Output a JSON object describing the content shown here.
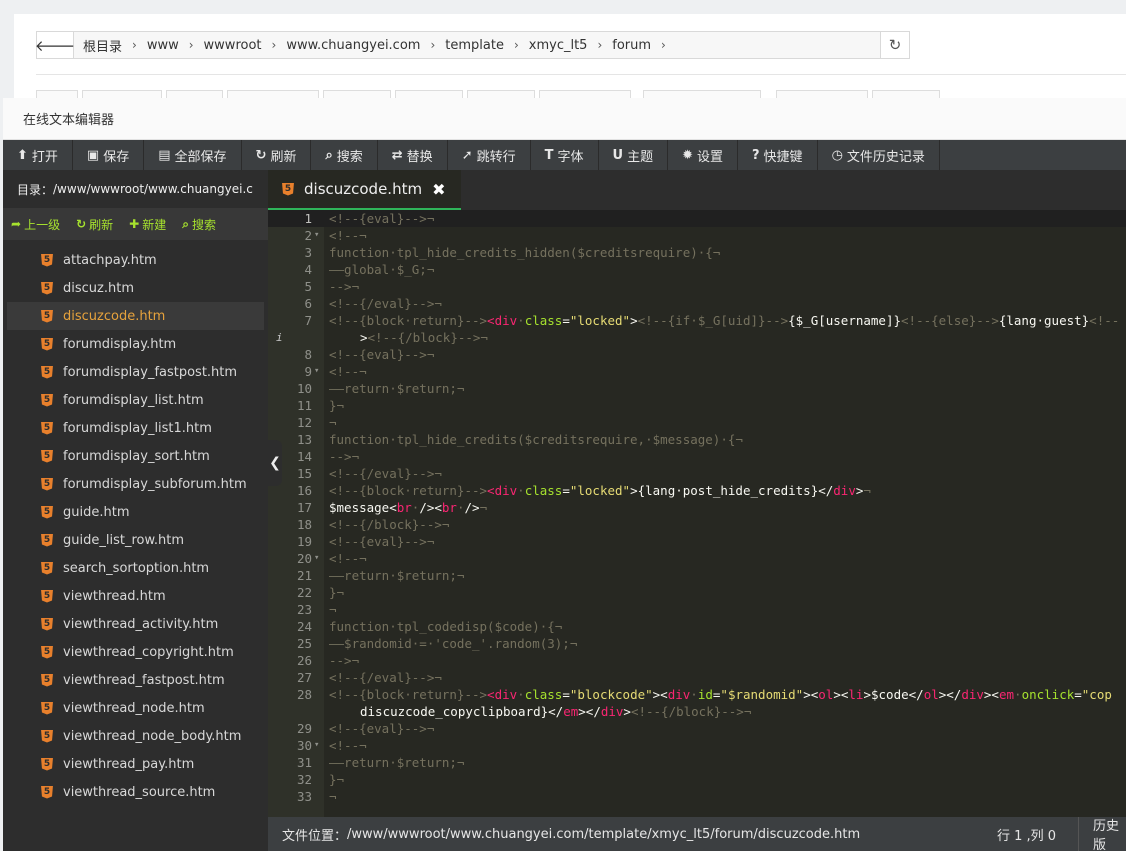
{
  "breadcrumb": [
    "根目录",
    "www",
    "wwwroot",
    "www.chuangyei.com",
    "template",
    "xmyc_lt5",
    "forum"
  ],
  "editor_title": "在线文本编辑器",
  "toolbar": [
    {
      "icon": "upload-icon",
      "glyph": "⬆",
      "label": "打开"
    },
    {
      "icon": "save-icon",
      "glyph": "▣",
      "label": "保存"
    },
    {
      "icon": "save-all-icon",
      "glyph": "▤",
      "label": "全部保存"
    },
    {
      "icon": "refresh-icon",
      "glyph": "↻",
      "label": "刷新"
    },
    {
      "icon": "search-icon",
      "glyph": "⌕",
      "label": "搜索"
    },
    {
      "icon": "replace-icon",
      "glyph": "⇄",
      "label": "替换"
    },
    {
      "icon": "goto-line-icon",
      "glyph": "➚",
      "label": "跳转行"
    },
    {
      "icon": "font-icon",
      "glyph": "T",
      "label": "字体"
    },
    {
      "icon": "theme-icon",
      "glyph": "U",
      "label": "主题"
    },
    {
      "icon": "settings-icon",
      "glyph": "✹",
      "label": "设置"
    },
    {
      "icon": "help-icon",
      "glyph": "?",
      "label": "快捷键"
    },
    {
      "icon": "history-icon",
      "glyph": "◷",
      "label": "文件历史记录"
    }
  ],
  "sidebar": {
    "dir_label": "目录：",
    "dir_path": "/www/wwwroot/www.chuangyei.c",
    "actions": [
      {
        "icon": "arrow-up-icon",
        "glyph": "➦",
        "label": "上一级"
      },
      {
        "icon": "refresh-icon",
        "glyph": "↻",
        "label": "刷新"
      },
      {
        "icon": "plus-icon",
        "glyph": "✚",
        "label": "新建"
      },
      {
        "icon": "search-icon",
        "glyph": "⌕",
        "label": "搜索"
      }
    ],
    "files": [
      "attachpay.htm",
      "discuz.htm",
      "discuzcode.htm",
      "forumdisplay.htm",
      "forumdisplay_fastpost.htm",
      "forumdisplay_list.htm",
      "forumdisplay_list1.htm",
      "forumdisplay_sort.htm",
      "forumdisplay_subforum.htm",
      "guide.htm",
      "guide_list_row.htm",
      "search_sortoption.htm",
      "viewthread.htm",
      "viewthread_activity.htm",
      "viewthread_copyright.htm",
      "viewthread_fastpost.htm",
      "viewthread_node.htm",
      "viewthread_node_body.htm",
      "viewthread_pay.htm",
      "viewthread_source.htm"
    ],
    "active_file": "discuzcode.htm"
  },
  "tab": {
    "label": "discuzcode.htm",
    "close": "✖"
  },
  "code_lines": [
    {
      "n": "1",
      "fold": "",
      "segs": [
        [
          "c",
          "<!--{eval}-->¬"
        ]
      ]
    },
    {
      "n": "2",
      "fold": "▾",
      "segs": [
        [
          "c",
          "<!--¬"
        ]
      ]
    },
    {
      "n": "3",
      "fold": "",
      "segs": [
        [
          "c",
          "function·tpl_hide_credits_hidden($creditsrequire)·{¬"
        ]
      ]
    },
    {
      "n": "4",
      "fold": "",
      "segs": [
        [
          "c",
          "——global·$_G;¬"
        ]
      ]
    },
    {
      "n": "5",
      "fold": "",
      "segs": [
        [
          "c",
          "-->¬"
        ]
      ]
    },
    {
      "n": "6",
      "fold": "",
      "segs": [
        [
          "c",
          "<!--{/eval}-->¬"
        ]
      ]
    },
    {
      "n": "7",
      "fold": "",
      "segs": [
        [
          "c",
          "<!--{block·return}-->"
        ],
        [
          "t",
          "<div"
        ],
        [
          "c",
          "·"
        ],
        [
          "a",
          "class"
        ],
        [
          "w",
          "="
        ],
        [
          "s",
          "\"locked\""
        ],
        [
          "w",
          ">"
        ],
        [
          "c",
          "<!--{if·$_G[uid]}-->"
        ],
        [
          "w",
          "{$_G[username]}"
        ],
        [
          "c",
          "<!--{else}-->"
        ],
        [
          "w",
          "{lang·guest}"
        ],
        [
          "c",
          "<!--"
        ]
      ]
    },
    {
      "n": "",
      "fold": "",
      "wrap": true,
      "info": "i",
      "segs": [
        [
          "w",
          ">"
        ],
        [
          "c",
          "<!--{/block}-->¬"
        ]
      ]
    },
    {
      "n": "8",
      "fold": "",
      "segs": [
        [
          "c",
          "<!--{eval}-->¬"
        ]
      ]
    },
    {
      "n": "9",
      "fold": "▾",
      "segs": [
        [
          "c",
          "<!--¬"
        ]
      ]
    },
    {
      "n": "10",
      "fold": "",
      "segs": [
        [
          "c",
          "——return·$return;¬"
        ]
      ]
    },
    {
      "n": "11",
      "fold": "",
      "segs": [
        [
          "c",
          "}¬"
        ]
      ]
    },
    {
      "n": "12",
      "fold": "",
      "segs": [
        [
          "c",
          "¬"
        ]
      ]
    },
    {
      "n": "13",
      "fold": "",
      "segs": [
        [
          "c",
          "function·tpl_hide_credits($creditsrequire,·$message)·{¬"
        ]
      ]
    },
    {
      "n": "14",
      "fold": "",
      "segs": [
        [
          "c",
          "-->¬"
        ]
      ]
    },
    {
      "n": "15",
      "fold": "",
      "segs": [
        [
          "c",
          "<!--{/eval}-->¬"
        ]
      ]
    },
    {
      "n": "16",
      "fold": "",
      "segs": [
        [
          "c",
          "<!--{block·return}-->"
        ],
        [
          "t",
          "<div"
        ],
        [
          "c",
          "·"
        ],
        [
          "a",
          "class"
        ],
        [
          "w",
          "="
        ],
        [
          "s",
          "\"locked\""
        ],
        [
          "w",
          ">{lang·post_hide_credits}</"
        ],
        [
          "t",
          "div"
        ],
        [
          "w",
          ">"
        ],
        [
          "c",
          "¬"
        ]
      ]
    },
    {
      "n": "17",
      "fold": "",
      "segs": [
        [
          "w",
          "$message<"
        ],
        [
          "t",
          "br"
        ],
        [
          "c",
          "·"
        ],
        [
          "w",
          "/><"
        ],
        [
          "t",
          "br"
        ],
        [
          "c",
          "·"
        ],
        [
          "w",
          "/>"
        ],
        [
          "c",
          "¬"
        ]
      ]
    },
    {
      "n": "18",
      "fold": "",
      "segs": [
        [
          "c",
          "<!--{/block}-->¬"
        ]
      ]
    },
    {
      "n": "19",
      "fold": "",
      "segs": [
        [
          "c",
          "<!--{eval}-->¬"
        ]
      ]
    },
    {
      "n": "20",
      "fold": "▾",
      "segs": [
        [
          "c",
          "<!--¬"
        ]
      ]
    },
    {
      "n": "21",
      "fold": "",
      "segs": [
        [
          "c",
          "——return·$return;¬"
        ]
      ]
    },
    {
      "n": "22",
      "fold": "",
      "segs": [
        [
          "c",
          "}¬"
        ]
      ]
    },
    {
      "n": "23",
      "fold": "",
      "segs": [
        [
          "c",
          "¬"
        ]
      ]
    },
    {
      "n": "24",
      "fold": "",
      "segs": [
        [
          "c",
          "function·tpl_codedisp($code)·{¬"
        ]
      ]
    },
    {
      "n": "25",
      "fold": "",
      "segs": [
        [
          "c",
          "——$randomid·=·'code_'.random(3);¬"
        ]
      ]
    },
    {
      "n": "26",
      "fold": "",
      "segs": [
        [
          "c",
          "-->¬"
        ]
      ]
    },
    {
      "n": "27",
      "fold": "",
      "segs": [
        [
          "c",
          "<!--{/eval}-->¬"
        ]
      ]
    },
    {
      "n": "28",
      "fold": "",
      "segs": [
        [
          "c",
          "<!--{block·return}-->"
        ],
        [
          "t",
          "<div"
        ],
        [
          "c",
          "·"
        ],
        [
          "a",
          "class"
        ],
        [
          "w",
          "="
        ],
        [
          "s",
          "\"blockcode\""
        ],
        [
          "w",
          "><"
        ],
        [
          "t",
          "div"
        ],
        [
          "c",
          "·"
        ],
        [
          "a",
          "id"
        ],
        [
          "w",
          "="
        ],
        [
          "s",
          "\"$randomid\""
        ],
        [
          "w",
          "><"
        ],
        [
          "t",
          "ol"
        ],
        [
          "w",
          "><"
        ],
        [
          "t",
          "li"
        ],
        [
          "w",
          ">$code</"
        ],
        [
          "t",
          "ol"
        ],
        [
          "w",
          "></"
        ],
        [
          "t",
          "div"
        ],
        [
          "w",
          "><"
        ],
        [
          "t",
          "em"
        ],
        [
          "c",
          "·"
        ],
        [
          "a",
          "onclick"
        ],
        [
          "w",
          "="
        ],
        [
          "s",
          "\"cop"
        ]
      ]
    },
    {
      "n": "",
      "fold": "",
      "wrap": true,
      "segs": [
        [
          "w",
          "discuzcode_copyclipboard}</"
        ],
        [
          "t",
          "em"
        ],
        [
          "w",
          "></"
        ],
        [
          "t",
          "div"
        ],
        [
          "w",
          ">"
        ],
        [
          "c",
          "<!--{/block}-->¬"
        ]
      ]
    },
    {
      "n": "29",
      "fold": "",
      "segs": [
        [
          "c",
          "<!--{eval}-->¬"
        ]
      ]
    },
    {
      "n": "30",
      "fold": "▾",
      "segs": [
        [
          "c",
          "<!--¬"
        ]
      ]
    },
    {
      "n": "31",
      "fold": "",
      "segs": [
        [
          "c",
          "——return·$return;¬"
        ]
      ]
    },
    {
      "n": "32",
      "fold": "",
      "segs": [
        [
          "c",
          "}¬"
        ]
      ]
    },
    {
      "n": "33",
      "fold": "",
      "segs": [
        [
          "c",
          "¬"
        ]
      ]
    }
  ],
  "status": {
    "location_label": "文件位置：",
    "location": "/www/wwwroot/www.chuangyei.com/template/xmyc_lt5/forum/discuzcode.htm",
    "position": "行 1 ,列 0",
    "history": "历史版"
  }
}
